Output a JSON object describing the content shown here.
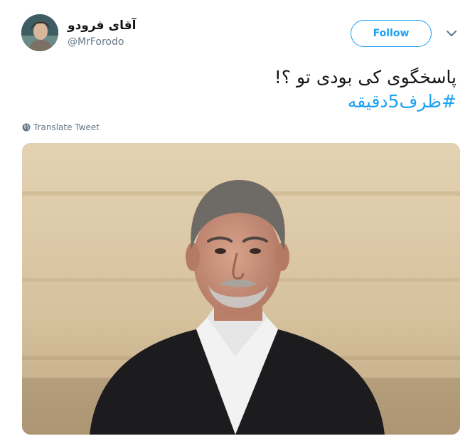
{
  "author": {
    "display_name": "آقای فرودو",
    "handle": "@MrForodo",
    "avatar_icon": "avatar-photo"
  },
  "actions": {
    "follow_label": "Follow",
    "more_icon": "chevron-down-icon"
  },
  "tweet": {
    "text": "پاسخگوی کی بودی تو ؟!",
    "hashtag": "#ظرف5دقیقه"
  },
  "translate": {
    "label": "Translate Tweet",
    "icon": "globe-icon"
  },
  "media": {
    "type": "photo",
    "subject": "man-in-suit-portrait"
  },
  "colors": {
    "accent": "#1da1f2",
    "text": "#14171a",
    "secondary": "#657786"
  }
}
